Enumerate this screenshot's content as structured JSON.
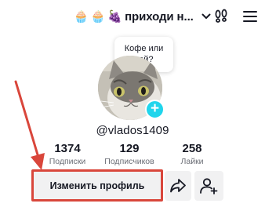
{
  "header": {
    "username_emojis": [
      "🧁",
      "🧁",
      "🍇"
    ],
    "username": "приходи н...",
    "chevron_icon": "chevron-down-icon",
    "footprint_icon": "footprints-icon",
    "menu_icon": "hamburger-menu-icon"
  },
  "profile": {
    "note": "Кофе или чай?",
    "handle": "@vlados1409"
  },
  "stats": [
    {
      "value": "1374",
      "label": "Подписки"
    },
    {
      "value": "129",
      "label": "Подписчиков"
    },
    {
      "value": "258",
      "label": "Лайки"
    }
  ],
  "actions": {
    "edit_profile_label": "Изменить профиль",
    "share_icon": "share-arrow-icon",
    "add_friend_icon": "add-friend-icon"
  },
  "colors": {
    "accent_cyan": "#20d5ec",
    "annotation_red": "#d9463b",
    "button_bg": "#f1f1f2"
  }
}
